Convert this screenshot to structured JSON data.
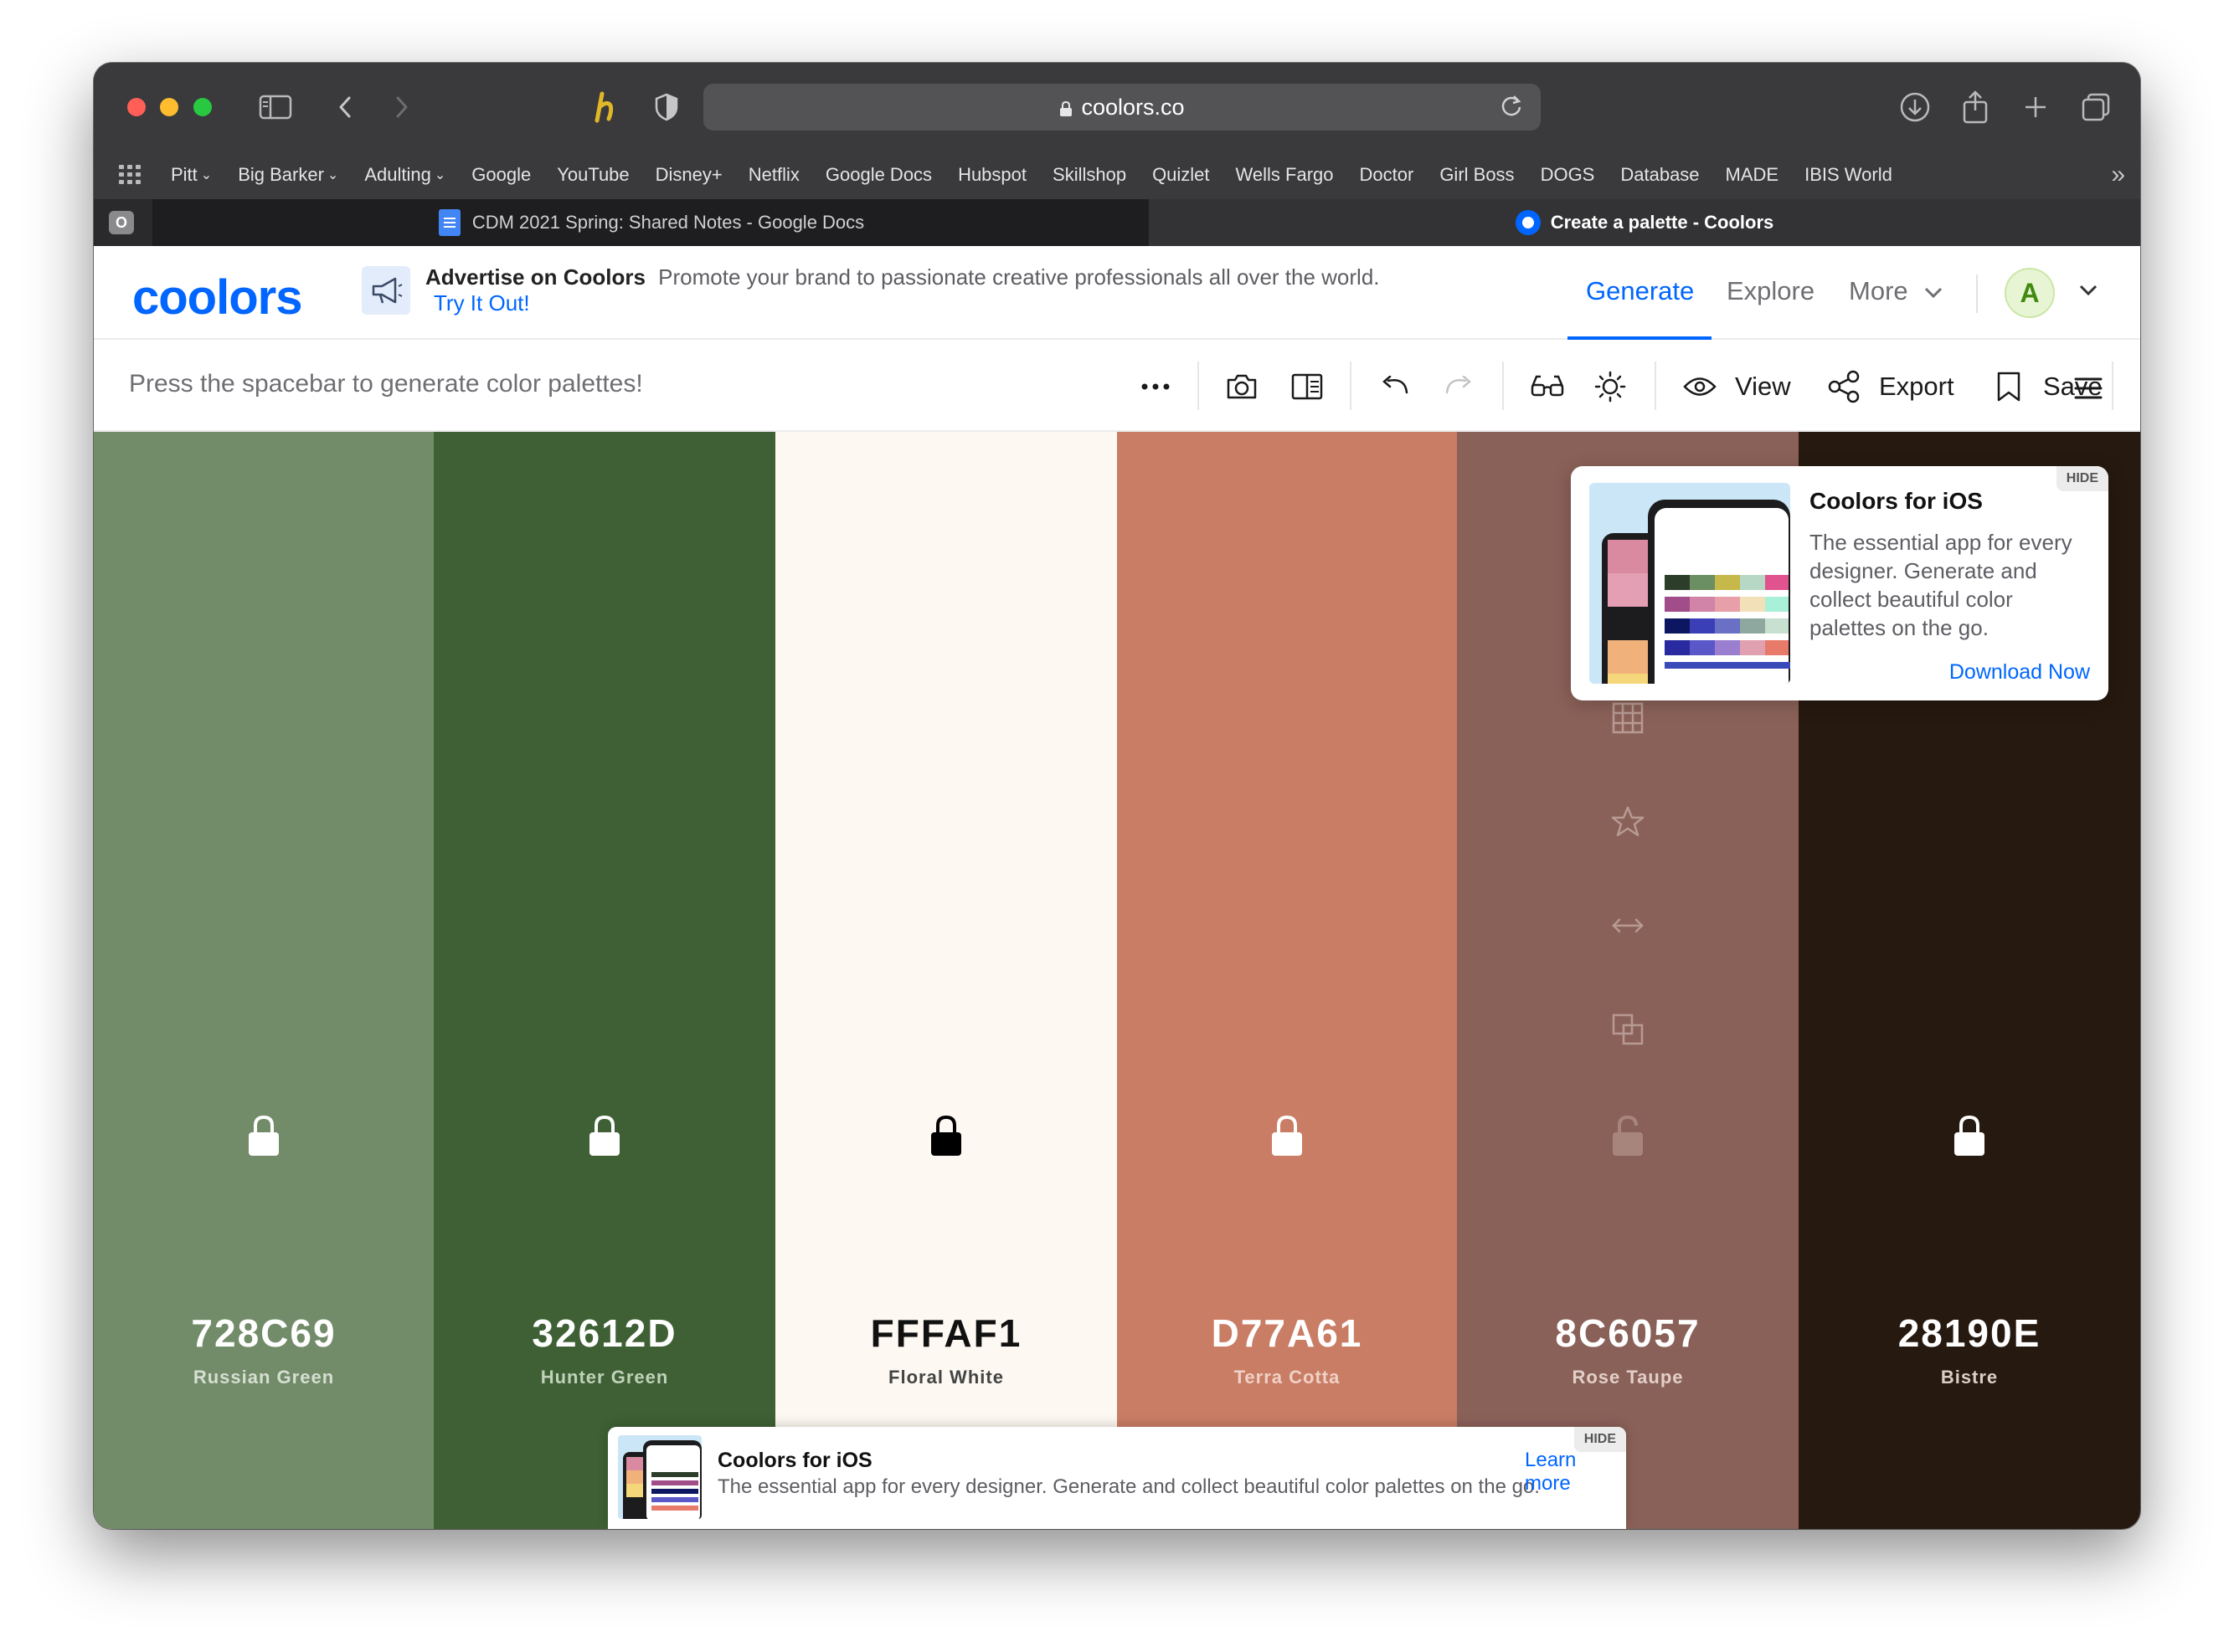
{
  "browser": {
    "url": "coolors.co",
    "bookmarks": [
      {
        "label": "Pitt",
        "has_menu": true
      },
      {
        "label": "Big Barker",
        "has_menu": true
      },
      {
        "label": "Adulting",
        "has_menu": true
      },
      {
        "label": "Google",
        "has_menu": false
      },
      {
        "label": "YouTube",
        "has_menu": false
      },
      {
        "label": "Disney+",
        "has_menu": false
      },
      {
        "label": "Netflix",
        "has_menu": false
      },
      {
        "label": "Google Docs",
        "has_menu": false
      },
      {
        "label": "Hubspot",
        "has_menu": false
      },
      {
        "label": "Skillshop",
        "has_menu": false
      },
      {
        "label": "Quizlet",
        "has_menu": false
      },
      {
        "label": "Wells Fargo",
        "has_menu": false
      },
      {
        "label": "Doctor",
        "has_menu": false
      },
      {
        "label": "Girl Boss",
        "has_menu": false
      },
      {
        "label": "DOGS",
        "has_menu": false
      },
      {
        "label": "Database",
        "has_menu": false
      },
      {
        "label": "MADE",
        "has_menu": false
      },
      {
        "label": "IBIS World",
        "has_menu": false
      }
    ],
    "tab_badge": "O",
    "tabs": [
      {
        "title": "CDM 2021 Spring: Shared Notes - Google Docs",
        "active": false
      },
      {
        "title": "Create a palette - Coolors",
        "active": true
      }
    ]
  },
  "header": {
    "logo": "coolors",
    "ad_title": "Advertise on Coolors",
    "ad_text": "Promote your brand to passionate creative professionals all over the world.",
    "ad_link": "Try It Out!",
    "nav": {
      "generate": "Generate",
      "explore": "Explore",
      "more": "More"
    },
    "avatar_initial": "A"
  },
  "toolbar": {
    "hint": "Press the spacebar to generate color palettes!",
    "view_label": "View",
    "export_label": "Export",
    "save_label": "Save"
  },
  "palette": [
    {
      "hex": "728C69",
      "name": "Russian Green",
      "color": "#728C69",
      "text_color": "#ffffff",
      "name_color": "#d6dfd2",
      "locked": false
    },
    {
      "hex": "32612D",
      "name": "Hunter Green",
      "color": "#3E6034",
      "text_color": "#ffffff",
      "name_color": "#bfd2b9",
      "locked": false
    },
    {
      "hex": "FFFAF1",
      "name": "Floral White",
      "color": "#FDF8F1",
      "text_color": "#111111",
      "name_color": "#444444",
      "locked": false
    },
    {
      "hex": "D77A61",
      "name": "Terra Cotta",
      "color": "#C97D65",
      "text_color": "#ffffff",
      "name_color": "#f0d1c6",
      "locked": false
    },
    {
      "hex": "8C6057",
      "name": "Rose Taupe",
      "color": "#8A6158",
      "text_color": "#ffffff",
      "name_color": "#e3cfca",
      "locked": false
    },
    {
      "hex": "28190E",
      "name": "Bistre",
      "color": "#26190F",
      "text_color": "#ffffff",
      "name_color": "#d9cfc7",
      "locked": false
    }
  ],
  "popup": {
    "hide": "HIDE",
    "title": "Coolors for iOS",
    "body": "The essential app for every designer. Generate and collect beautiful color palettes on the go.",
    "link": "Download Now"
  },
  "bottom_ad": {
    "hide": "HIDE",
    "title": "Coolors for iOS",
    "body": "The essential app for every designer. Generate and collect beautiful color palettes on the go.",
    "link": "Learn more"
  },
  "colors": {
    "accent": "#0066ff"
  }
}
